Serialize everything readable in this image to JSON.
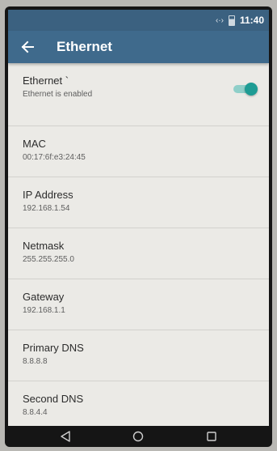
{
  "status_bar": {
    "sync_icon": "data-sync-icon",
    "battery_icon": "battery-icon",
    "time": "11:40"
  },
  "toolbar": {
    "back_icon": "arrow-left-icon",
    "title": "Ethernet"
  },
  "items": [
    {
      "title": "Ethernet `",
      "value": "Ethernet is enabled",
      "toggle_on": true
    },
    {
      "title": "MAC",
      "value": "00:17:6f:e3:24:45"
    },
    {
      "title": "IP Address",
      "value": "192.168.1.54"
    },
    {
      "title": "Netmask",
      "value": "255.255.255.0"
    },
    {
      "title": "Gateway",
      "value": "192.168.1.1"
    },
    {
      "title": "Primary DNS",
      "value": "8.8.8.8"
    },
    {
      "title": "Second DNS",
      "value": "8.8.4.4"
    }
  ],
  "nav": {
    "back_icon": "triangle-back-icon",
    "home_icon": "circle-home-icon",
    "recents_icon": "square-recents-icon"
  },
  "colors": {
    "toolbar": "#3f6a8c",
    "status_bar": "#3b6180",
    "accent": "#1e9c94",
    "background": "#ebeae6"
  }
}
